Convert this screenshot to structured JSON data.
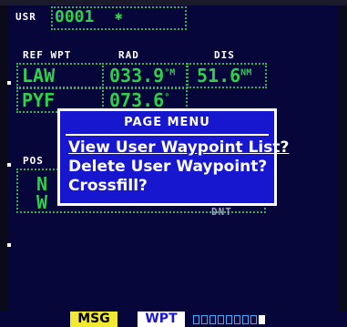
{
  "header": {
    "usr_label": "USR",
    "usr_value": "0001",
    "usr_symbol": "✱"
  },
  "columns": {
    "ref_wpt": "REF WPT",
    "rad": "RAD",
    "dis": "DIS"
  },
  "rows": [
    {
      "ref": "LAW",
      "rad": "033.9",
      "rad_unit": "°M",
      "dis": "51.6",
      "dis_unit": "NM"
    },
    {
      "ref": "PYF",
      "rad": "073.6",
      "rad_unit": "°"
    }
  ],
  "position_label": "POS",
  "position_fragments": {
    "lat_hint": "N",
    "lon_hint": "W",
    "time_hint": "DNT"
  },
  "menu": {
    "title": "PAGE MENU",
    "items": [
      "View User Waypoint List?",
      "Delete User Waypoint?",
      "Crossfill?"
    ],
    "selected_index": 0
  },
  "status_bar": {
    "msg_label": "MSG",
    "wpt_label": "WPT",
    "pages": 9,
    "active_page": 9
  },
  "colors": {
    "background": "#06063a",
    "green_text": "#2fd04a",
    "menu_bg": "#1717d0",
    "msg_yellow": "#f1e832"
  }
}
